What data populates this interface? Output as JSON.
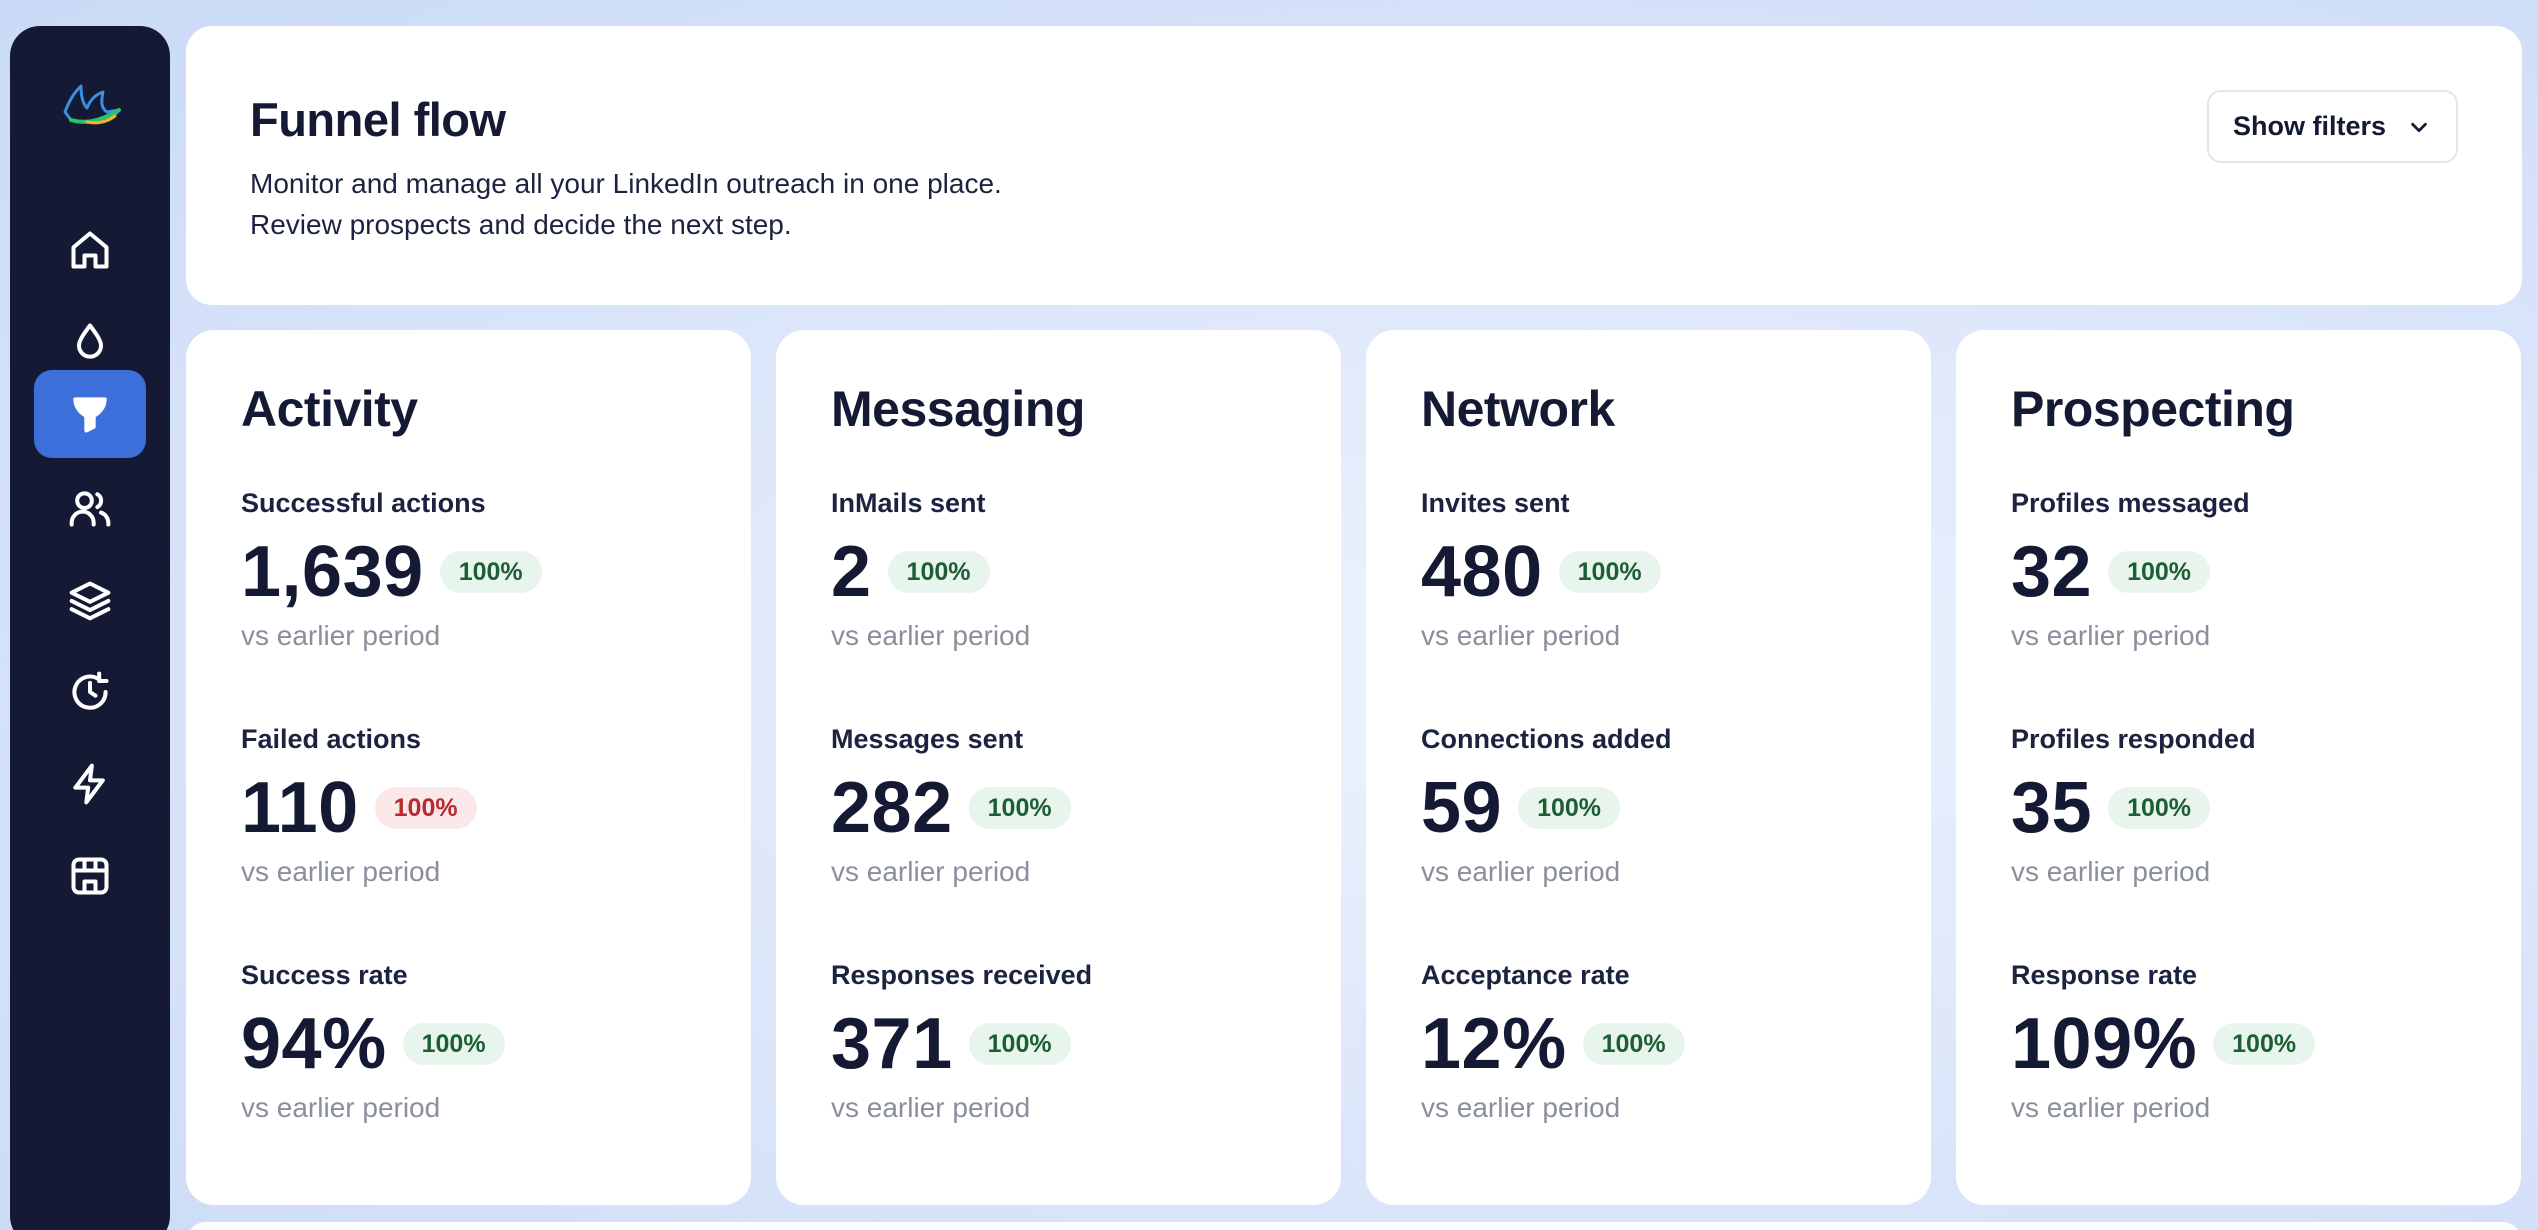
{
  "header": {
    "title": "Funnel flow",
    "subtitle_line1": "Monitor and manage all your LinkedIn outreach in one place.",
    "subtitle_line2": "Review prospects and decide the next step.",
    "filters_label": "Show filters",
    "filters_icon": "chevron-down-icon"
  },
  "sidebar": {
    "logo": "bird-logo",
    "items": [
      {
        "icon": "home-icon",
        "active": false
      },
      {
        "icon": "drop-icon",
        "active": false
      },
      {
        "icon": "funnel-icon",
        "active": true
      },
      {
        "icon": "users-icon",
        "active": false
      },
      {
        "icon": "layers-icon",
        "active": false
      },
      {
        "icon": "history-icon",
        "active": false
      },
      {
        "icon": "lightning-icon",
        "active": false
      },
      {
        "icon": "store-icon",
        "active": false
      }
    ]
  },
  "cards": [
    {
      "title": "Activity",
      "metrics": [
        {
          "label": "Successful actions",
          "value": "1,639",
          "change": "100%",
          "trend": "up",
          "caption": "vs earlier period"
        },
        {
          "label": "Failed actions",
          "value": "110",
          "change": "100%",
          "trend": "down",
          "caption": "vs earlier period"
        },
        {
          "label": "Success rate",
          "value": "94%",
          "change": "100%",
          "trend": "up",
          "caption": "vs earlier period"
        }
      ]
    },
    {
      "title": "Messaging",
      "metrics": [
        {
          "label": "InMails sent",
          "value": "2",
          "change": "100%",
          "trend": "up",
          "caption": "vs earlier period"
        },
        {
          "label": "Messages sent",
          "value": "282",
          "change": "100%",
          "trend": "up",
          "caption": "vs earlier period"
        },
        {
          "label": "Responses received",
          "value": "371",
          "change": "100%",
          "trend": "up",
          "caption": "vs earlier period"
        }
      ]
    },
    {
      "title": "Network",
      "metrics": [
        {
          "label": "Invites sent",
          "value": "480",
          "change": "100%",
          "trend": "up",
          "caption": "vs earlier period"
        },
        {
          "label": "Connections added",
          "value": "59",
          "change": "100%",
          "trend": "up",
          "caption": "vs earlier period"
        },
        {
          "label": "Acceptance rate",
          "value": "12%",
          "change": "100%",
          "trend": "up",
          "caption": "vs earlier period"
        }
      ]
    },
    {
      "title": "Prospecting",
      "metrics": [
        {
          "label": "Profiles messaged",
          "value": "32",
          "change": "100%",
          "trend": "up",
          "caption": "vs earlier period"
        },
        {
          "label": "Profiles responded",
          "value": "35",
          "change": "100%",
          "trend": "up",
          "caption": "vs earlier period"
        },
        {
          "label": "Response rate",
          "value": "109%",
          "change": "100%",
          "trend": "up",
          "caption": "vs earlier period"
        }
      ]
    }
  ],
  "colors": {
    "sidebar_bg": "#141a33",
    "accent": "#3c6fd9",
    "badge_up_bg": "#e7f5ec",
    "badge_up_text": "#1d5e35",
    "badge_down_bg": "#fbe9ea",
    "badge_down_text": "#b72a31"
  }
}
